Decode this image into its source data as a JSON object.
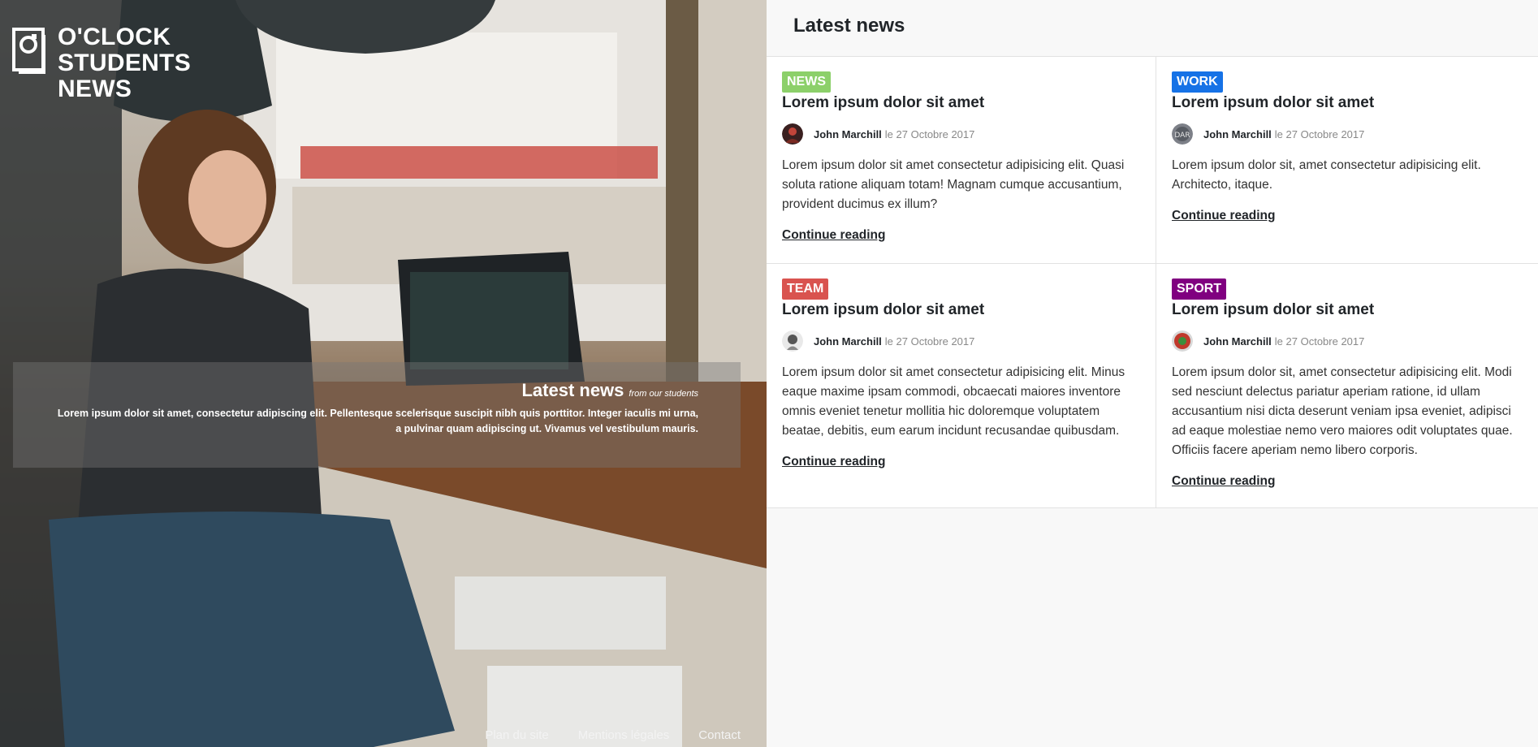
{
  "brand": {
    "line1": "O'CLOCK",
    "line2": "STUDENTS",
    "line3": "NEWS"
  },
  "hero": {
    "caption_title": "Latest news",
    "caption_sub": "from our students",
    "caption_body": "Lorem ipsum dolor sit amet, consectetur adipiscing elit. Pellentesque scelerisque suscipit nibh quis porttitor. Integer iaculis mi urna, a pulvinar quam adipiscing ut. Vivamus vel vestibulum mauris."
  },
  "footer": {
    "sitemap": "Plan du site",
    "legal": "Mentions légales",
    "contact": "Contact"
  },
  "section_title": "Latest news",
  "articles": [
    {
      "tag": "NEWS",
      "tag_color": "#8cd06a",
      "title": "Lorem ipsum dolor sit amet",
      "author": "John Marchill",
      "date": "le 27 Octobre 2017",
      "excerpt": "Lorem ipsum dolor sit amet consectetur adipisicing elit. Quasi soluta ratione aliquam totam! Magnam cumque accusantium, provident ducimus ex illum?",
      "more": "Continue reading"
    },
    {
      "tag": "WORK",
      "tag_color": "#1672e6",
      "title": "Lorem ipsum dolor sit amet",
      "author": "John Marchill",
      "date": "le 27 Octobre 2017",
      "excerpt": "Lorem ipsum dolor sit, amet consectetur adipisicing elit. Architecto, itaque.",
      "more": "Continue reading"
    },
    {
      "tag": "TEAM",
      "tag_color": "#d9534f",
      "title": "Lorem ipsum dolor sit amet",
      "author": "John Marchill",
      "date": "le 27 Octobre 2017",
      "excerpt": "Lorem ipsum dolor sit amet consectetur adipisicing elit. Minus eaque maxime ipsam commodi, obcaecati maiores inventore omnis eveniet tenetur mollitia hic doloremque voluptatem beatae, debitis, eum earum incidunt recusandae quibusdam.",
      "more": "Continue reading"
    },
    {
      "tag": "SPORT",
      "tag_color": "#800080",
      "title": "Lorem ipsum dolor sit amet",
      "author": "John Marchill",
      "date": "le 27 Octobre 2017",
      "excerpt": "Lorem ipsum dolor sit, amet consectetur adipisicing elit. Modi sed nesciunt delectus pariatur aperiam ratione, id ullam accusantium nisi dicta deserunt veniam ipsa eveniet, adipisci ad eaque molestiae nemo vero maiores odit voluptates quae. Officiis facere aperiam nemo libero corporis.",
      "more": "Continue reading"
    }
  ]
}
